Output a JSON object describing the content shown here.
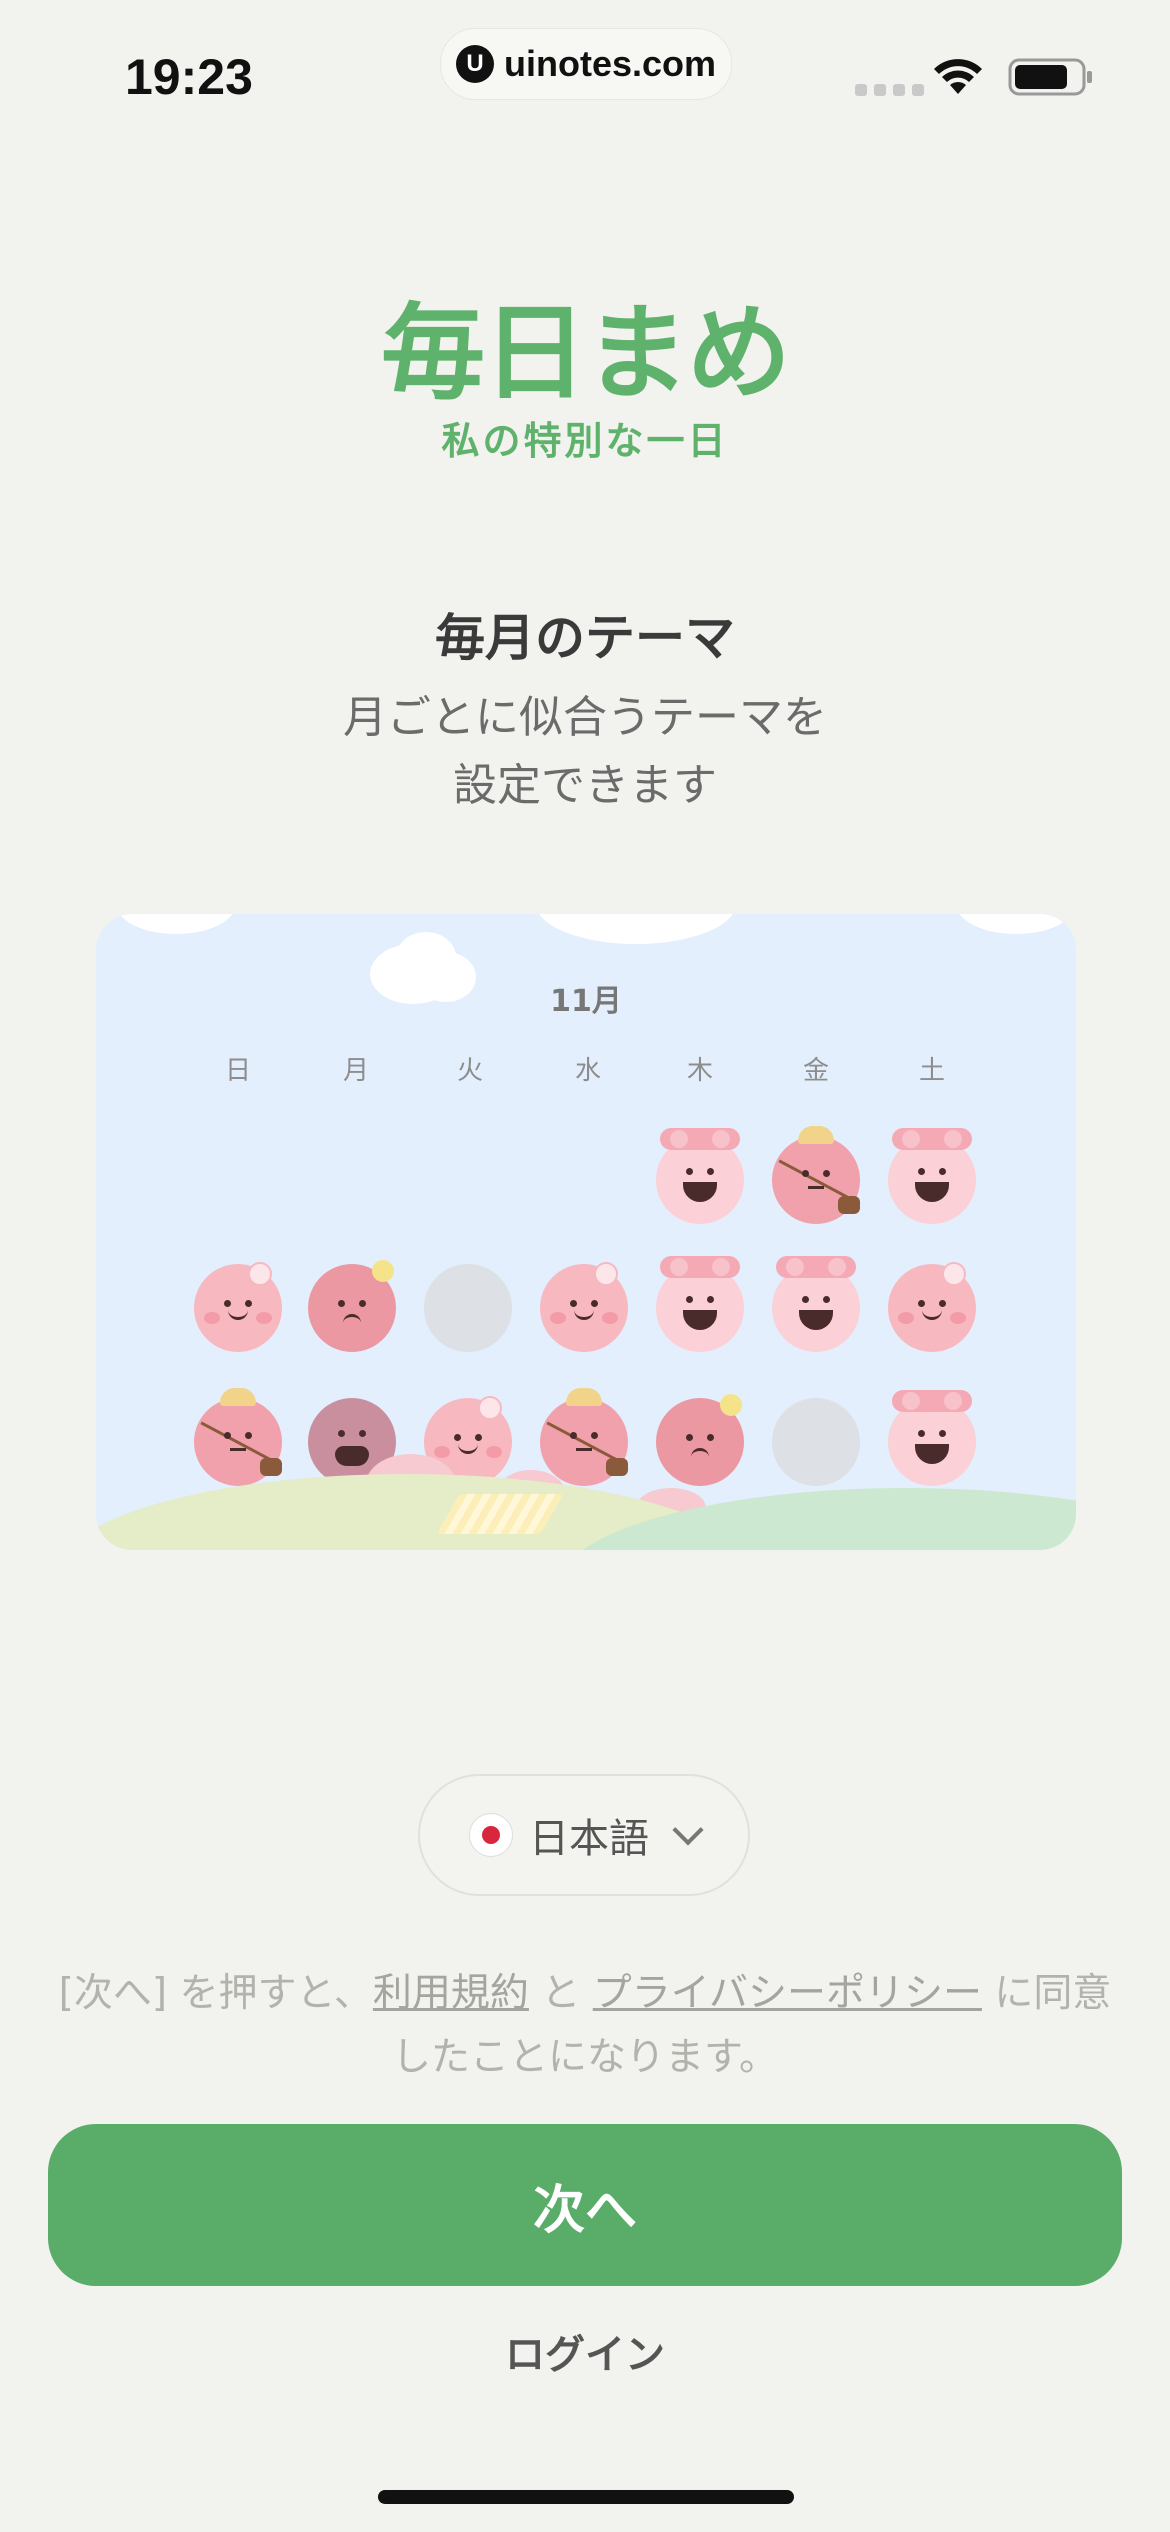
{
  "status_bar": {
    "time": "19:23",
    "url": "uinotes.com"
  },
  "logo": {
    "title": "毎日まめ",
    "subtitle": "私の特別な一日"
  },
  "feature": {
    "title": "毎月のテーマ",
    "description_line1": "月ごとに似合うテーマを",
    "description_line2": "設定できます"
  },
  "calendar": {
    "month": "11月",
    "weekdays": [
      "日",
      "月",
      "火",
      "水",
      "木",
      "金",
      "土"
    ],
    "theme_colors": {
      "sky": "#e3effc",
      "mood_pink": "#f6b7bf",
      "empty_day": "#dde0e5"
    }
  },
  "language": {
    "selected": "日本語",
    "flag_icon": "japan-flag-icon"
  },
  "terms": {
    "prefix": "[次へ] を押すと、",
    "terms_link": "利用規約",
    "middle": " と ",
    "privacy_link": "プライバシーポリシー",
    "suffix": " に同意したことになります。"
  },
  "actions": {
    "next_label": "次へ",
    "login_label": "ログイン"
  },
  "colors": {
    "brand_green": "#59ad69",
    "background": "#f2f2ee"
  }
}
